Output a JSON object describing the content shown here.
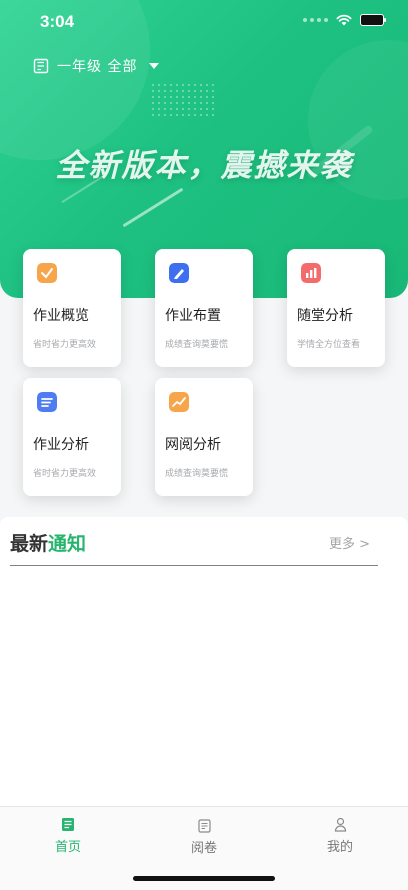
{
  "status": {
    "time": "3:04"
  },
  "header": {
    "grade_selector": "一年级 全部"
  },
  "banner": {
    "slogan": "全新版本，震撼来袭"
  },
  "features": [
    {
      "title": "作业概览",
      "subtitle": "省时省力更高效",
      "icon": "homework-overview-icon",
      "color": "#f7a54b"
    },
    {
      "title": "作业布置",
      "subtitle": "成绩查询莫要慌",
      "icon": "assign-pen-icon",
      "color": "#3d6ff0"
    },
    {
      "title": "随堂分析",
      "subtitle": "学情全方位查看",
      "icon": "class-chart-icon",
      "color": "#f46b6b"
    },
    {
      "title": "作业分析",
      "subtitle": "省时省力更高效",
      "icon": "homework-list-icon",
      "color": "#4f7cf2"
    },
    {
      "title": "网阅分析",
      "subtitle": "成绩查询莫要慌",
      "icon": "trend-icon",
      "color": "#f7a54b"
    }
  ],
  "notice": {
    "title_main": "最新",
    "title_accent": "通知",
    "more": "更多 >",
    "accent_color": "#27b46f"
  },
  "tabbar": {
    "home": "首页",
    "review": "阅卷",
    "mine": "我的",
    "active_color": "#27b46f"
  }
}
